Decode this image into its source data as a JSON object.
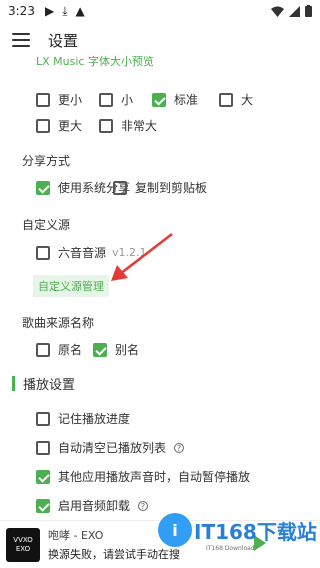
{
  "status_bar": {
    "time": "3:23",
    "icons": [
      "play-icon",
      "download-icon",
      "app-icon",
      "wifi-icon",
      "signal-icon",
      "battery-icon"
    ]
  },
  "header": {
    "title": "设置"
  },
  "font_size": {
    "preview_label": "LX Music 字体大小预览",
    "options": [
      {
        "label": "更小",
        "checked": false
      },
      {
        "label": "小",
        "checked": false
      },
      {
        "label": "标准",
        "checked": true
      },
      {
        "label": "大",
        "checked": false
      },
      {
        "label": "更大",
        "checked": false
      },
      {
        "label": "非常大",
        "checked": false
      }
    ]
  },
  "share": {
    "label": "分享方式",
    "options": [
      {
        "label": "使用系统分享",
        "checked": true
      },
      {
        "label": "复制到剪贴板",
        "checked": false
      }
    ]
  },
  "custom_source": {
    "label": "自定义源",
    "item": {
      "label": "六音音源",
      "version": "v1.2.1",
      "checked": false
    },
    "manage_button": "自定义源管理"
  },
  "source_name": {
    "label": "歌曲来源名称",
    "options": [
      {
        "label": "原名",
        "checked": false
      },
      {
        "label": "别名",
        "checked": true
      }
    ]
  },
  "playback": {
    "heading": "播放设置",
    "options": [
      {
        "label": "记住播放进度",
        "checked": false
      },
      {
        "label": "自动清空已播放列表",
        "checked": false,
        "help": "?"
      },
      {
        "label": "其他应用播放声音时，自动暂停播放",
        "checked": true
      },
      {
        "label": "启用音频卸载",
        "checked": true,
        "help": "?"
      }
    ]
  },
  "player": {
    "album_text": [
      "VVXO",
      "EXO"
    ],
    "track_title": "咆哮 - EXO",
    "status": "换源失败，请尝试手动在搜"
  },
  "watermark": {
    "main": "IT168下载站",
    "circle": "i",
    "sub": "IT168 Download"
  },
  "colors": {
    "accent": "#4caf50",
    "text": "#333333",
    "watermark": "#1976d2"
  }
}
